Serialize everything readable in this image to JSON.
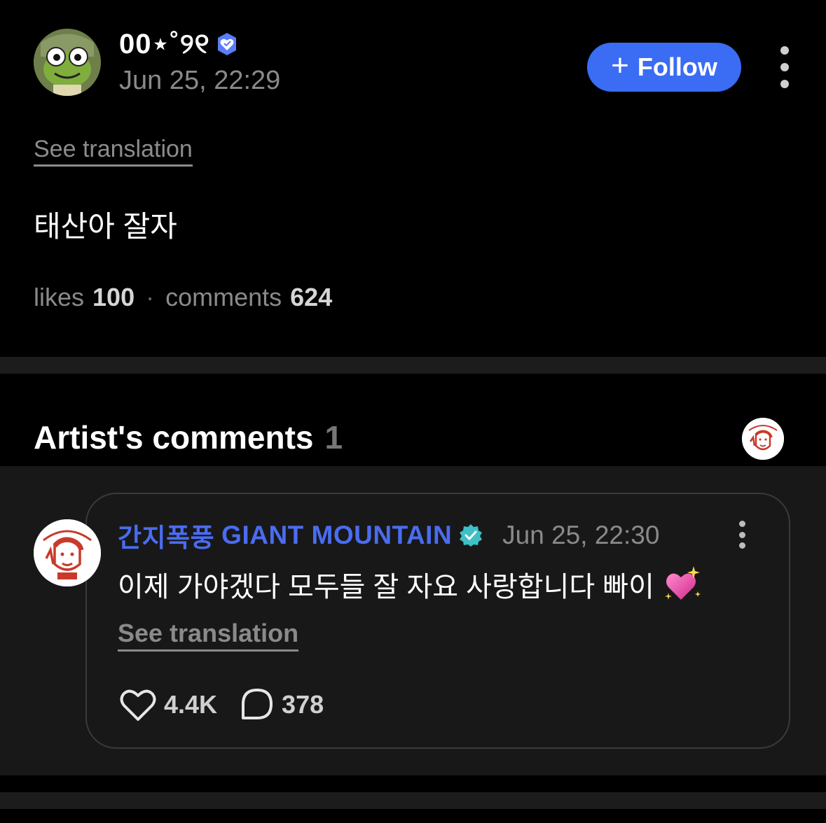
{
  "post": {
    "author": "00⋆˚୨୧",
    "date": "Jun 25, 22:29",
    "follow_label": "Follow",
    "see_translation": "See translation",
    "text": "태산아 잘자",
    "likes_label": "likes",
    "likes_count": "100",
    "separator": "·",
    "comments_label": "comments",
    "comments_count": "624"
  },
  "artist_comments": {
    "title": "Artist's comments",
    "count": "1",
    "comment": {
      "author_kr": "간지폭풍",
      "author_en": "GIANT MOUNTAIN",
      "date": "Jun 25, 22:30",
      "text": "이제 가야겠다 모두들 잘 자요 사랑합니다 빠이",
      "emoji_icon": "sparkling-heart-icon",
      "see_translation": "See translation",
      "likes": "4.4K",
      "replies": "378"
    }
  },
  "colors": {
    "accent_blue": "#3a6cf4",
    "author_blue": "#4a6cf0",
    "background": "#000000",
    "card_background": "#181818"
  }
}
